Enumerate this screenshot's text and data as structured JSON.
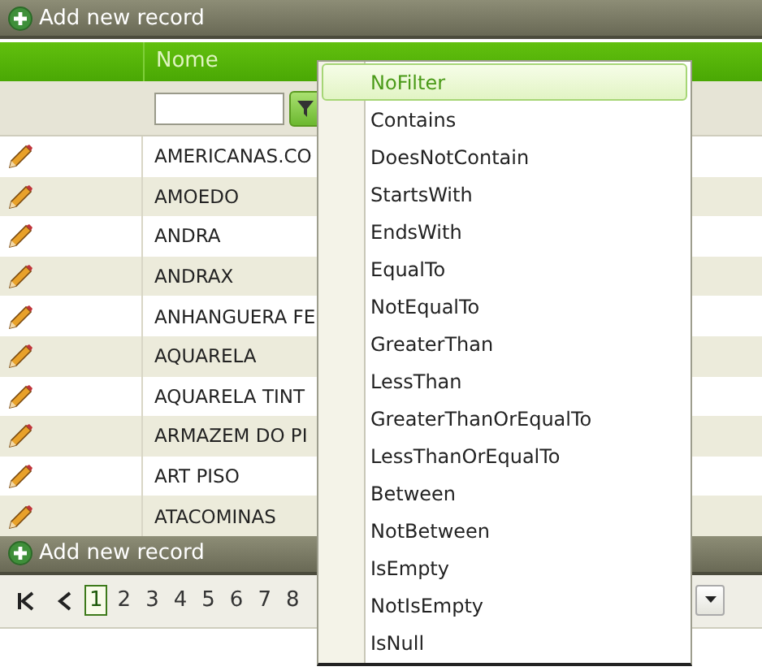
{
  "top_toolbar": {
    "label": "Add new record"
  },
  "table": {
    "columns": [
      {
        "label": "Nome"
      }
    ],
    "rows": [
      {
        "nome": "AMERICANAS.CO"
      },
      {
        "nome": "AMOEDO"
      },
      {
        "nome": "ANDRA"
      },
      {
        "nome": "ANDRAX"
      },
      {
        "nome": "ANHANGUERA FE"
      },
      {
        "nome": "AQUARELA"
      },
      {
        "nome": "AQUARELA TINT"
      },
      {
        "nome": "ARMAZEM DO PI"
      },
      {
        "nome": "ART PISO"
      },
      {
        "nome": "ATACOMINAS"
      }
    ]
  },
  "bottom_toolbar": {
    "label": "Add new record"
  },
  "pager": {
    "pages": [
      {
        "label": "1",
        "selected": true
      },
      {
        "label": "2",
        "selected": false
      },
      {
        "label": "3",
        "selected": false
      },
      {
        "label": "4",
        "selected": false
      },
      {
        "label": "5",
        "selected": false
      },
      {
        "label": "6",
        "selected": false
      },
      {
        "label": "7",
        "selected": false
      },
      {
        "label": "8",
        "selected": false
      }
    ]
  },
  "filter_menu": {
    "items": [
      {
        "label": "NoFilter",
        "selected": true
      },
      {
        "label": "Contains",
        "selected": false
      },
      {
        "label": "DoesNotContain",
        "selected": false
      },
      {
        "label": "StartsWith",
        "selected": false
      },
      {
        "label": "EndsWith",
        "selected": false
      },
      {
        "label": "EqualTo",
        "selected": false
      },
      {
        "label": "NotEqualTo",
        "selected": false
      },
      {
        "label": "GreaterThan",
        "selected": false
      },
      {
        "label": "LessThan",
        "selected": false
      },
      {
        "label": "GreaterThanOrEqualTo",
        "selected": false
      },
      {
        "label": "LessThanOrEqualTo",
        "selected": false
      },
      {
        "label": "Between",
        "selected": false
      },
      {
        "label": "NotBetween",
        "selected": false
      },
      {
        "label": "IsEmpty",
        "selected": false
      },
      {
        "label": "NotIsEmpty",
        "selected": false
      },
      {
        "label": "IsNull",
        "selected": false
      }
    ]
  }
}
